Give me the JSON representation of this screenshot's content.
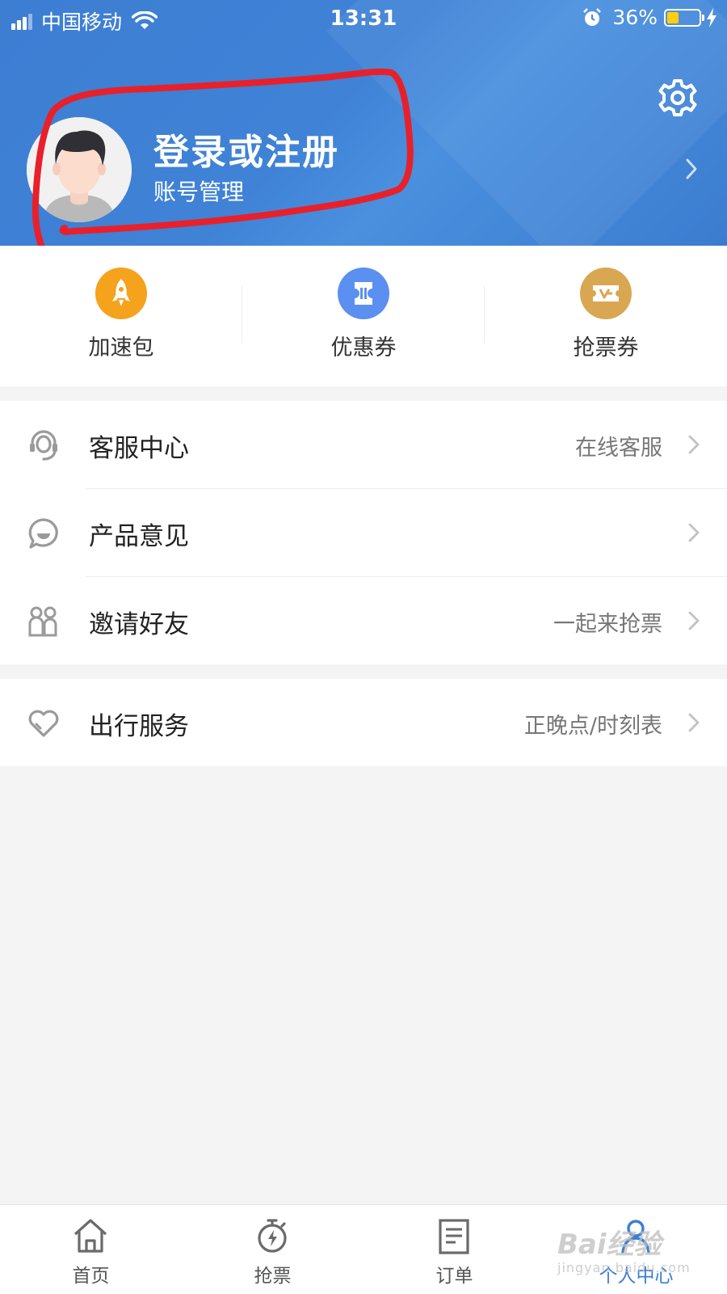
{
  "status_bar": {
    "carrier": "中国移动",
    "time": "13:31",
    "battery": "36%",
    "battery_level": 0.36
  },
  "profile": {
    "title": "登录或注册",
    "subtitle": "账号管理"
  },
  "quick_actions": [
    {
      "label": "加速包",
      "icon": "rocket-icon",
      "color": "#f5a21c"
    },
    {
      "label": "优惠券",
      "icon": "coupon-icon",
      "color": "#5b8ff0"
    },
    {
      "label": "抢票券",
      "icon": "ticket-icon",
      "color": "#d9a752"
    }
  ],
  "menu_groups": [
    {
      "items": [
        {
          "label": "客服中心",
          "value": "在线客服",
          "icon": "headset-icon"
        },
        {
          "label": "产品意见",
          "value": "",
          "icon": "feedback-chat-icon"
        },
        {
          "label": "邀请好友",
          "value": "一起来抢票",
          "icon": "friends-icon"
        }
      ]
    },
    {
      "items": [
        {
          "label": "出行服务",
          "value": "正晚点/时刻表",
          "icon": "heart-icon"
        }
      ]
    }
  ],
  "tabbar": [
    {
      "label": "首页",
      "icon": "home-icon",
      "active": false
    },
    {
      "label": "抢票",
      "icon": "stopwatch-icon",
      "active": false
    },
    {
      "label": "订单",
      "icon": "order-list-icon",
      "active": false
    },
    {
      "label": "个人中心",
      "icon": "person-icon",
      "active": true
    }
  ],
  "watermark": {
    "logo": "Bai经验",
    "url": "jingyan.baidu.com"
  },
  "colors": {
    "header_blue": "#3d7ed3",
    "active_tab": "#3a7fd4",
    "annotation_red": "#e8202a"
  }
}
